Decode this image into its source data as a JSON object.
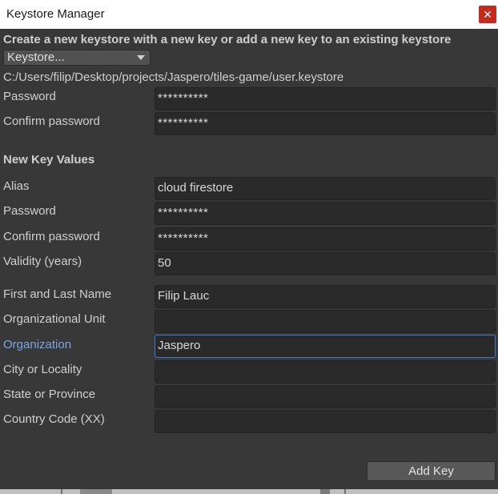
{
  "window": {
    "title": "Keystore Manager",
    "close_icon": "close-icon",
    "close_glyph": "✕"
  },
  "keystore": {
    "heading": "Create a new keystore with a new key or add a new key to an existing keystore",
    "dropdown_label": "Keystore...",
    "path": "C:/Users/filip/Desktop/projects/Jaspero/tiles-game/user.keystore",
    "password_label": "Password",
    "password_value": "**********",
    "confirm_label": "Confirm password",
    "confirm_value": "**********"
  },
  "new_key": {
    "heading": "New Key Values",
    "fields": [
      {
        "label": "Alias",
        "value": "cloud firestore"
      },
      {
        "label": "Password",
        "value": "**********"
      },
      {
        "label": "Confirm password",
        "value": "**********"
      },
      {
        "label": "Validity (years)",
        "value": "50"
      },
      {
        "label": "First and Last Name",
        "value": "Filip Lauc"
      },
      {
        "label": "Organizational Unit",
        "value": ""
      },
      {
        "label": "Organization",
        "value": "Jaspero"
      },
      {
        "label": "City or Locality",
        "value": ""
      },
      {
        "label": "State or Province",
        "value": ""
      },
      {
        "label": "Country Code (XX)",
        "value": ""
      }
    ]
  },
  "actions": {
    "add_key_label": "Add Key"
  },
  "colors": {
    "background": "#383838",
    "field_bg": "#2a2a2a",
    "focus_accent": "#3a79d8",
    "close_red": "#c42b1c"
  }
}
